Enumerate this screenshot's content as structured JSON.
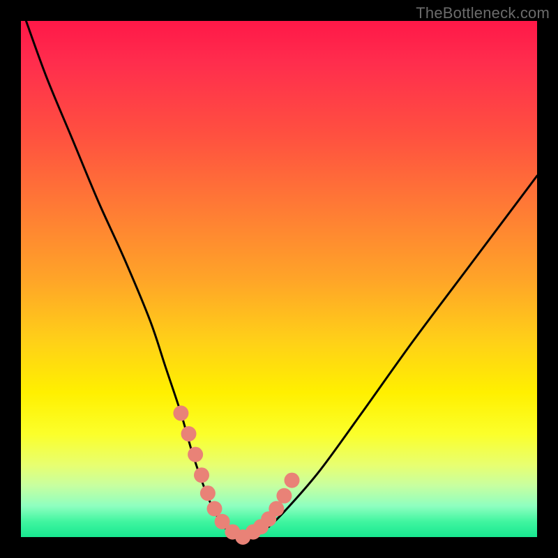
{
  "watermark": "TheBottleneck.com",
  "chart_data": {
    "type": "line",
    "title": "",
    "xlabel": "",
    "ylabel": "",
    "xlim": [
      0,
      100
    ],
    "ylim": [
      0,
      100
    ],
    "series": [
      {
        "name": "curve",
        "x": [
          1,
          5,
          10,
          15,
          20,
          25,
          28,
          31,
          33,
          35,
          37,
          39,
          41,
          43,
          45,
          48,
          52,
          58,
          66,
          76,
          88,
          100
        ],
        "y": [
          100,
          89,
          77,
          65,
          54,
          42,
          33,
          24,
          17,
          11,
          6,
          2.5,
          0.5,
          0,
          0.5,
          2,
          6,
          13,
          24,
          38,
          54,
          70
        ]
      }
    ],
    "highlight_points": {
      "name": "marker-cluster",
      "x": [
        31,
        32.5,
        33.8,
        35,
        36.2,
        37.5,
        39,
        41,
        43,
        45,
        46.5,
        48,
        49.5,
        51,
        52.5
      ],
      "y": [
        24,
        20,
        16,
        12,
        8.5,
        5.5,
        3,
        1,
        0,
        1,
        2,
        3.5,
        5.5,
        8,
        11
      ]
    },
    "colors": {
      "curve": "#000000",
      "markers": "#e98277",
      "background_top": "#ff1848",
      "background_bottom": "#18e890"
    }
  }
}
